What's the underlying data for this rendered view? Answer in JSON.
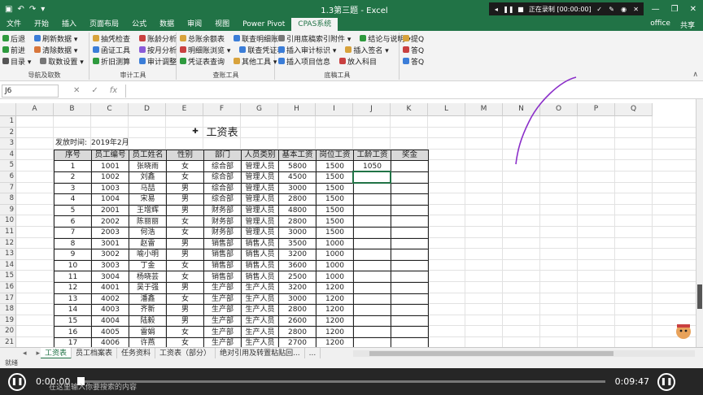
{
  "titlebar": {
    "title": "1.3第三题 - Excel",
    "recording": "正在录制 [00:00:00]",
    "minimize": "—",
    "restore": "❐",
    "close": "✕"
  },
  "tabs": [
    "文件",
    "开始",
    "插入",
    "页面布局",
    "公式",
    "数据",
    "审阅",
    "视图",
    "Power Pivot",
    "CPAS系统"
  ],
  "tabs_right": {
    "account": "office",
    "share": "共享"
  },
  "ribbon": {
    "groups": [
      {
        "label": "导航及取数",
        "rows": [
          [
            "后退",
            "刷新数据 ▾"
          ],
          [
            "前进",
            "清除数据 ▾"
          ],
          [
            "目录 ▾",
            "取数设置 ▾"
          ]
        ]
      },
      {
        "label": "审计工具",
        "rows": [
          [
            "抽凭检查",
            "账龄分析"
          ],
          [
            "函证工具",
            "按月分析"
          ],
          [
            "折旧测算",
            "审计调整"
          ]
        ]
      },
      {
        "label": "查账工具",
        "rows": [
          [
            "总账余额表",
            "联查明细账"
          ],
          [
            "明细账浏览 ▾",
            "联查凭证表"
          ],
          [
            "凭证表查询",
            "其他工具 ▾"
          ]
        ]
      },
      {
        "label": "底稿工具",
        "rows": [
          [
            "引用底稿索引附件 ▾",
            "结论与说明 ▾"
          ],
          [
            "插入审计标识 ▾",
            "插入签名 ▾"
          ],
          [
            "插入项目信息",
            "放入科目"
          ]
        ]
      },
      {
        "label": "",
        "rows": [
          [
            "提Q"
          ],
          [
            "答Q"
          ],
          [
            "答Q"
          ]
        ]
      }
    ]
  },
  "formula_bar": {
    "name_box": "J6",
    "cancel": "✕",
    "enter": "✓",
    "fx": "fx",
    "value": ""
  },
  "columns": [
    "A",
    "B",
    "C",
    "D",
    "E",
    "F",
    "G",
    "H",
    "I",
    "J",
    "K",
    "L",
    "M",
    "N",
    "O",
    "P",
    "Q"
  ],
  "rows": [
    1,
    2,
    3,
    4,
    5,
    6,
    7,
    8,
    9,
    10,
    11,
    12,
    13,
    14,
    15,
    16,
    17,
    18,
    19,
    20,
    21
  ],
  "sheet": {
    "title": "工资表",
    "issue_label": "发放时间:",
    "issue_value": "2019年2月",
    "headers": [
      "序号",
      "员工编号",
      "员工姓名",
      "性别",
      "部门",
      "人员类别",
      "基本工资",
      "岗位工资",
      "工龄工资",
      "奖金"
    ],
    "data": [
      [
        "1",
        "1001",
        "张晓雨",
        "女",
        "综合部",
        "管理人员",
        "5800",
        "1500",
        "1050",
        ""
      ],
      [
        "2",
        "1002",
        "刘鑫",
        "女",
        "综合部",
        "管理人员",
        "4500",
        "1500",
        "",
        ""
      ],
      [
        "3",
        "1003",
        "马喆",
        "男",
        "综合部",
        "管理人员",
        "3000",
        "1500",
        "",
        ""
      ],
      [
        "4",
        "1004",
        "宋易",
        "男",
        "综合部",
        "管理人员",
        "2800",
        "1500",
        "",
        ""
      ],
      [
        "5",
        "2001",
        "王增辉",
        "男",
        "财务部",
        "管理人员",
        "4800",
        "1500",
        "",
        ""
      ],
      [
        "6",
        "2002",
        "陈丽丽",
        "女",
        "财务部",
        "管理人员",
        "2800",
        "1500",
        "",
        ""
      ],
      [
        "7",
        "2003",
        "何浩",
        "女",
        "财务部",
        "管理人员",
        "3000",
        "1500",
        "",
        ""
      ],
      [
        "8",
        "3001",
        "赵雷",
        "男",
        "销售部",
        "销售人员",
        "3500",
        "1000",
        "",
        ""
      ],
      [
        "9",
        "3002",
        "喻小明",
        "男",
        "销售部",
        "销售人员",
        "3200",
        "1000",
        "",
        ""
      ],
      [
        "10",
        "3003",
        "丁金",
        "女",
        "销售部",
        "销售人员",
        "3600",
        "1000",
        "",
        ""
      ],
      [
        "11",
        "3004",
        "杨晓芸",
        "女",
        "销售部",
        "销售人员",
        "2500",
        "1000",
        "",
        ""
      ],
      [
        "12",
        "4001",
        "吴于强",
        "男",
        "生产部",
        "生产人员",
        "3200",
        "1200",
        "",
        ""
      ],
      [
        "13",
        "4002",
        "潘鑫",
        "女",
        "生产部",
        "生产人员",
        "3000",
        "1200",
        "",
        ""
      ],
      [
        "14",
        "4003",
        "齐新",
        "男",
        "生产部",
        "生产人员",
        "2800",
        "1200",
        "",
        ""
      ],
      [
        "15",
        "4004",
        "陆毅",
        "男",
        "生产部",
        "生产人员",
        "2600",
        "1200",
        "",
        ""
      ],
      [
        "16",
        "4005",
        "雷娟",
        "女",
        "生产部",
        "生产人员",
        "2800",
        "1200",
        "",
        ""
      ],
      [
        "17",
        "4006",
        "许燕",
        "女",
        "生产部",
        "生产人员",
        "2700",
        "1200",
        "",
        ""
      ]
    ]
  },
  "sheet_tabs": [
    "工资表",
    "员工档案表",
    "任务资料",
    "工资表（部分）",
    "绝对引用及转置粘贴回...",
    "..."
  ],
  "status": "就绪",
  "player": {
    "current_time": "0:00:00",
    "duration": "0:09:47",
    "search_hint": "在这里输入你要搜索的内容",
    "play_icon": "❚❚",
    "fullscreen_icon": "❚❚"
  },
  "colors": {
    "excel_green": "#217346",
    "annotation": "#8b2fc9"
  }
}
